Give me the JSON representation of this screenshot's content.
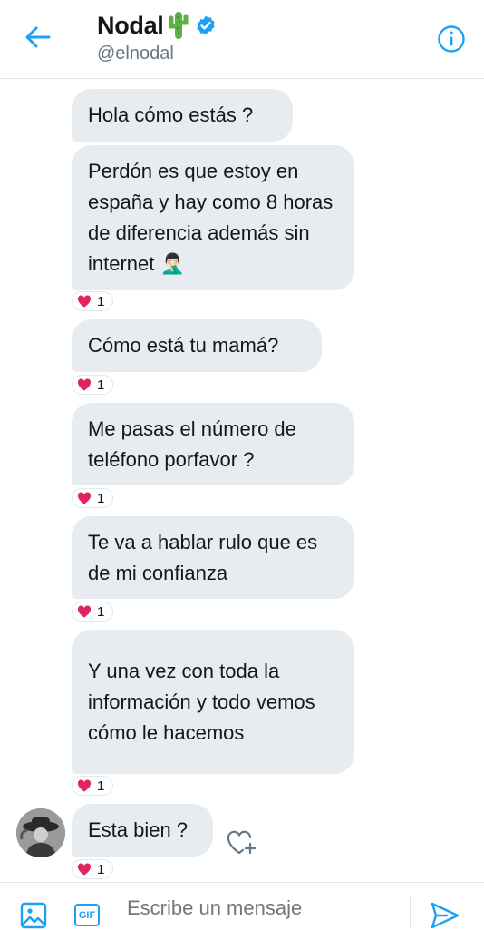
{
  "header": {
    "name": "Nodal",
    "handle": "@elnodal"
  },
  "messages": [
    {
      "text": "Hola cómo estás ?",
      "reaction_count": ""
    },
    {
      "text": "Perdón es que estoy en españa y hay como 8 horas de diferencia además sin internet",
      "emoji": "🤦🏻‍♂️",
      "reaction_count": "1"
    },
    {
      "text": "Cómo está tu mamá?",
      "reaction_count": "1"
    },
    {
      "text": "Me pasas el número de teléfono porfavor ?",
      "reaction_count": "1"
    },
    {
      "text": "Te va a hablar rulo que es de mi confianza",
      "reaction_count": "1"
    },
    {
      "text": "Y una vez con toda la información y todo vemos cómo le hacemos",
      "reaction_count": "1"
    },
    {
      "text": "Esta bien ?",
      "reaction_count": "1"
    }
  ],
  "composer": {
    "placeholder": "Escribe un mensaje",
    "gif_label": "GIF"
  },
  "colors": {
    "accent": "#1da1f2",
    "bubble": "#e6ecf0",
    "heart": "#e0245e"
  },
  "icons": [
    "back-arrow-icon",
    "cactus-emoji-icon",
    "verified-badge-icon",
    "info-icon",
    "heart-icon",
    "heart-plus-icon",
    "image-icon",
    "gif-icon",
    "send-icon"
  ]
}
